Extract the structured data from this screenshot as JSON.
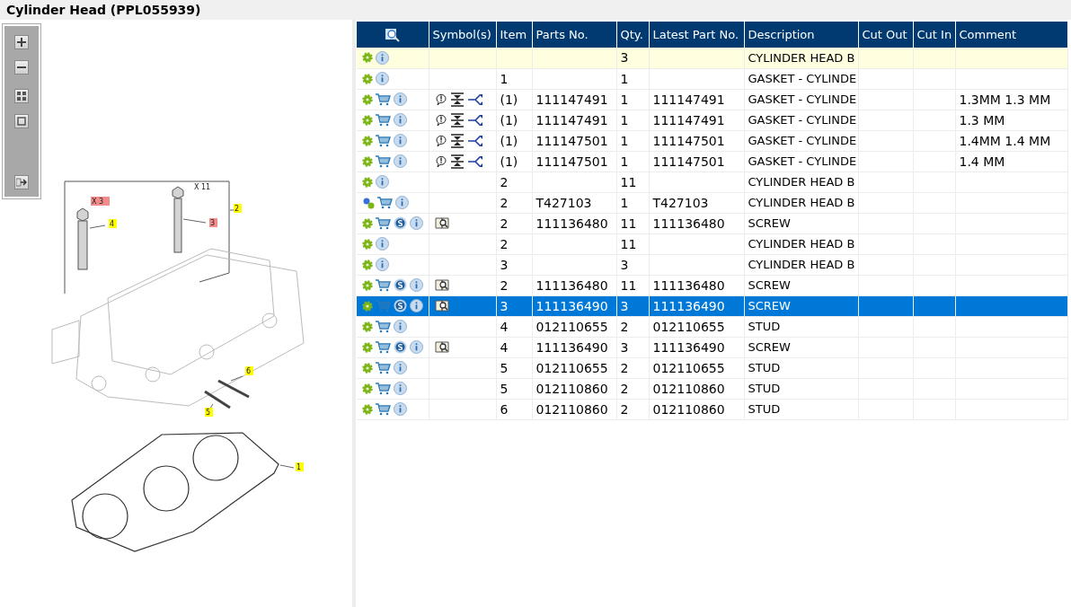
{
  "title": "Cylinder Head (PPL055939)",
  "diagram": {
    "callouts": [
      {
        "text": "X 3",
        "color": "#f28b8b"
      },
      {
        "text": "4",
        "color": "#ffff00"
      },
      {
        "text": "X 11"
      },
      {
        "text": "2",
        "color": "#ffff00"
      },
      {
        "text": "3",
        "color": "#f28b8b"
      },
      {
        "text": "6",
        "color": "#ffff00"
      },
      {
        "text": "5",
        "color": "#ffff00"
      },
      {
        "text": "1",
        "color": "#ffff00"
      }
    ]
  },
  "table": {
    "columns": [
      "Symbol(s)",
      "Item",
      "Parts No.",
      "Qty.",
      "Latest Part No.",
      "Description",
      "Cut Out",
      "Cut In",
      "Comment"
    ],
    "rows": [
      {
        "kind": "group",
        "item": "",
        "part": "",
        "qty": "3",
        "latest": "",
        "description": "CYLINDER HEAD B",
        "comment": "",
        "highlighted": true,
        "selected": false
      },
      {
        "kind": "group",
        "item": "1",
        "part": "",
        "qty": "1",
        "latest": "",
        "description": "GASKET - CYLINDE",
        "comment": "",
        "highlighted": false,
        "selected": false
      },
      {
        "kind": "option",
        "item": "(1)",
        "part": "111147491",
        "qty": "1",
        "latest": "111147491",
        "description": "GASKET - CYLINDE",
        "comment": "1.3MM  1.3 MM",
        "highlighted": false,
        "selected": false
      },
      {
        "kind": "option",
        "item": "(1)",
        "part": "111147491",
        "qty": "1",
        "latest": "111147491",
        "description": "GASKET - CYLINDE",
        "comment": "1.3 MM",
        "highlighted": false,
        "selected": false
      },
      {
        "kind": "option",
        "item": "(1)",
        "part": "111147501",
        "qty": "1",
        "latest": "111147501",
        "description": "GASKET - CYLINDE",
        "comment": "1.4MM  1.4 MM",
        "highlighted": false,
        "selected": false
      },
      {
        "kind": "option",
        "item": "(1)",
        "part": "111147501",
        "qty": "1",
        "latest": "111147501",
        "description": "GASKET - CYLINDE",
        "comment": "1.4 MM",
        "highlighted": false,
        "selected": false
      },
      {
        "kind": "group",
        "item": "2",
        "part": "",
        "qty": "11",
        "latest": "",
        "description": "CYLINDER HEAD B",
        "comment": "",
        "highlighted": false,
        "selected": false
      },
      {
        "kind": "kit",
        "item": "2",
        "part": "T427103",
        "qty": "1",
        "latest": "T427103",
        "description": "CYLINDER HEAD B",
        "comment": "",
        "highlighted": false,
        "selected": false
      },
      {
        "kind": "service",
        "item": "2",
        "part": "111136480",
        "qty": "11",
        "latest": "111136480",
        "description": "SCREW",
        "comment": "",
        "highlighted": false,
        "selected": false
      },
      {
        "kind": "group",
        "item": "2",
        "part": "",
        "qty": "11",
        "latest": "",
        "description": "CYLINDER HEAD B",
        "comment": "",
        "highlighted": false,
        "selected": false
      },
      {
        "kind": "group",
        "item": "3",
        "part": "",
        "qty": "3",
        "latest": "",
        "description": "CYLINDER HEAD B",
        "comment": "",
        "highlighted": false,
        "selected": false
      },
      {
        "kind": "service",
        "item": "2",
        "part": "111136480",
        "qty": "11",
        "latest": "111136480",
        "description": "SCREW",
        "comment": "",
        "highlighted": false,
        "selected": false
      },
      {
        "kind": "service",
        "item": "3",
        "part": "111136490",
        "qty": "3",
        "latest": "111136490",
        "description": "SCREW",
        "comment": "",
        "highlighted": false,
        "selected": true
      },
      {
        "kind": "part",
        "item": "4",
        "part": "012110655",
        "qty": "2",
        "latest": "012110655",
        "description": "STUD",
        "comment": "",
        "highlighted": false,
        "selected": false
      },
      {
        "kind": "service",
        "item": "4",
        "part": "111136490",
        "qty": "3",
        "latest": "111136490",
        "description": "SCREW",
        "comment": "",
        "highlighted": false,
        "selected": false
      },
      {
        "kind": "part",
        "item": "5",
        "part": "012110655",
        "qty": "2",
        "latest": "012110655",
        "description": "STUD",
        "comment": "",
        "highlighted": false,
        "selected": false
      },
      {
        "kind": "part",
        "item": "5",
        "part": "012110860",
        "qty": "2",
        "latest": "012110860",
        "description": "STUD",
        "comment": "",
        "highlighted": false,
        "selected": false
      },
      {
        "kind": "part",
        "item": "6",
        "part": "012110860",
        "qty": "2",
        "latest": "012110860",
        "description": "STUD",
        "comment": "",
        "highlighted": false,
        "selected": false
      }
    ]
  }
}
